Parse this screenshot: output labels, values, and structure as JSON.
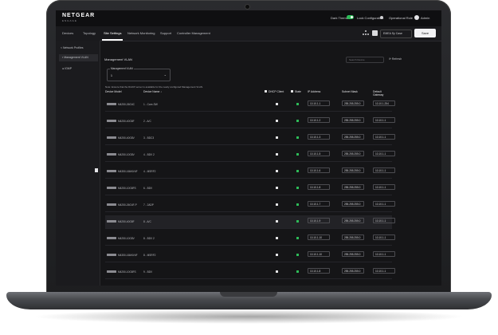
{
  "header": {
    "logo": "NETGEAR",
    "logo_sub": "ENGAGE",
    "dark_theme_label": "Dark Theme",
    "lock_config_label": "Lock Configuration",
    "user_label": "Admin",
    "account_label": "Operational Role"
  },
  "nav": {
    "tabs": [
      "Devices",
      "Topology",
      "Site Settings",
      "Network Monitoring",
      "Support",
      "Controller Management"
    ],
    "active": "Site Settings",
    "site_select": "EMEA Sy Case",
    "save_label": "Save"
  },
  "sidebar": {
    "title": "Network Profiles",
    "items": [
      "Management VLAN",
      "IGMP"
    ]
  },
  "main": {
    "breadcrumb": "Management VLAN",
    "search_placeholder": "Search Device",
    "refresh_label": "Refresh",
    "vlan_label": "Management VLAN",
    "vlan_value": "1",
    "note": "Note: Ensure that the DHCP server is available for the newly configured Management VLAN.",
    "columns": [
      "Device Model",
      "Device Name ↓",
      "DHCP Client",
      "State",
      "IP Address",
      "Subnet Mask",
      "Default Gateway"
    ]
  },
  "rows": [
    {
      "model": "M4250-26G4C",
      "name": "1 - Core-SW",
      "ip": "10.10.1.1",
      "mask": "255.255.255.0",
      "gw": "10.10.1.254"
    },
    {
      "model": "M4250-40G8F",
      "name": "2 - A/C",
      "ip": "10.10.1.2",
      "mask": "255.255.255.0",
      "gw": "10.10.1.1"
    },
    {
      "model": "M4250-40G8V",
      "name": "3 - BDC3",
      "ip": "10.10.1.3",
      "mask": "255.255.255.0",
      "gw": "10.10.1.1"
    },
    {
      "model": "M4250-10G8V",
      "name": "4 - BDV 2",
      "ip": "10.10.1.5",
      "mask": "255.255.255.0",
      "gw": "10.10.1.1"
    },
    {
      "model": "M4350-16M4V4F",
      "name": "4 - MSRF2",
      "ip": "10.10.1.6",
      "mask": "255.255.255.0",
      "gw": "10.10.1.1"
    },
    {
      "model": "M4250-10G8FS",
      "name": "6 - BDV",
      "ip": "10.10.1.8",
      "mask": "255.255.255.0",
      "gw": "10.10.1.1"
    },
    {
      "model": "M4250-26G4F-P",
      "name": "7 - 2ADP",
      "ip": "10.10.1.7",
      "mask": "255.255.255.0",
      "gw": "10.10.1.1"
    },
    {
      "model": "M4250-40G8F",
      "name": "8 - A/C",
      "ip": "10.10.1.9",
      "mask": "255.255.255.0",
      "gw": "10.10.1.1",
      "selected": true
    },
    {
      "model": "M4250-10G8V",
      "name": "8 - BDV 2",
      "ip": "10.10.1.10",
      "mask": "255.255.255.0",
      "gw": "10.10.1.1"
    },
    {
      "model": "M4350-16M4V4F",
      "name": "8 - MSRF2",
      "ip": "10.10.1.10",
      "mask": "255.255.255.0",
      "gw": "10.10.1.1"
    },
    {
      "model": "M4250-10G8FS",
      "name": "9 - BDV",
      "ip": "10.10.1.8",
      "mask": "255.255.255.0",
      "gw": "10.10.1.1"
    }
  ],
  "colors": {
    "accent": "#2ebd59",
    "background": "#151517"
  },
  "icons": [
    "grid-icon",
    "search-icon",
    "refresh-icon",
    "chevron-down-icon",
    "switch-icon",
    "avatar"
  ]
}
